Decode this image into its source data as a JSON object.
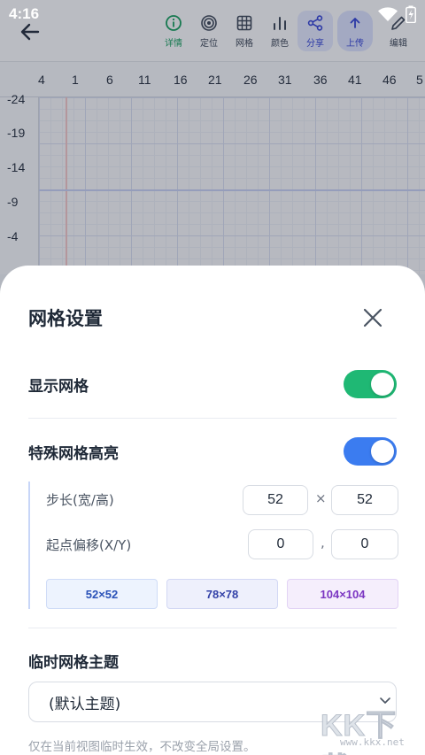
{
  "status_bar": {
    "time": "4:16"
  },
  "toolbar": {
    "items": [
      {
        "label": "详情",
        "icon": "info-icon"
      },
      {
        "label": "定位",
        "icon": "target-icon"
      },
      {
        "label": "网格",
        "icon": "grid-icon"
      },
      {
        "label": "颜色",
        "icon": "bar-chart-icon"
      },
      {
        "label": "分享",
        "icon": "share-icon"
      },
      {
        "label": "上传",
        "icon": "upload-icon"
      },
      {
        "label": "编辑",
        "icon": "pencil-icon"
      }
    ]
  },
  "ruler": {
    "x_ticks": [
      "4",
      "1",
      "6",
      "11",
      "16",
      "21",
      "26",
      "31",
      "36",
      "41",
      "46",
      "5"
    ],
    "y_ticks": [
      "-24",
      "-19",
      "-14",
      "-9",
      "-4"
    ]
  },
  "sheet": {
    "title": "网格设置",
    "show_grid": {
      "label": "显示网格",
      "on": true
    },
    "highlight": {
      "label": "特殊网格高亮",
      "on": true
    },
    "step": {
      "label": "步长(宽/高)",
      "width": "52",
      "sep": "×",
      "height": "52"
    },
    "offset": {
      "label": "起点偏移(X/Y)",
      "x": "0",
      "sep": ",",
      "y": "0"
    },
    "presets": [
      "52×52",
      "78×78",
      "104×104"
    ],
    "theme": {
      "label": "临时网格主题",
      "value": "(默认主题)"
    },
    "hint": "仅在当前视图临时生效，不改变全局设置。"
  },
  "watermark": {
    "big": "KK下载",
    "small": "www.kkx.net"
  },
  "colors": {
    "switch_green": "#1fb874",
    "switch_blue": "#3b7cf0",
    "accent_green": "#0f9d58"
  }
}
